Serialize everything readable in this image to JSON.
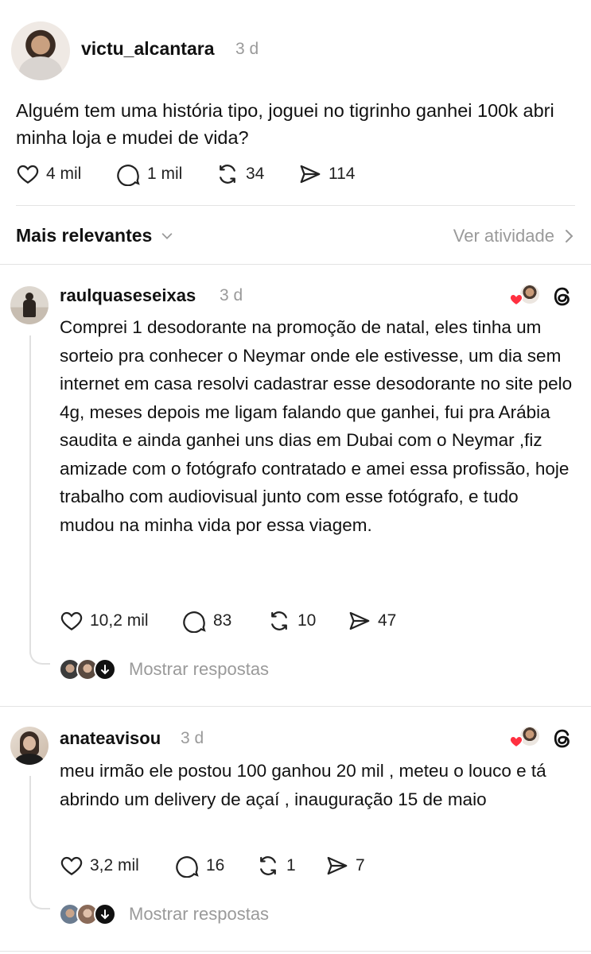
{
  "post": {
    "username": "victu_alcantara",
    "time": "3 d",
    "text": "Alguém tem uma história tipo, joguei no tigrinho ganhei 100k abri minha loja e mudei de vida?",
    "likes": "4 mil",
    "comments": "1 mil",
    "reposts": "34",
    "shares": "114"
  },
  "sort_bar": {
    "label": "Mais relevantes",
    "activity_link": "Ver atividade"
  },
  "replies": [
    {
      "username": "raulquaseseixas",
      "time": "3 d",
      "text": "Comprei 1 desodorante na promoção de natal, eles tinha um sorteio pra conhecer o Neymar onde ele estivesse, um dia sem internet em casa resolvi cadastrar esse desodorante no site pelo 4g, meses depois me ligam falando que ganhei, fui pra Arábia saudita e ainda ganhei uns dias em Dubai com o Neymar ,fiz amizade com o fotógrafo contratado e amei essa profissão, hoje trabalho com audiovisual junto com esse fotógrafo, e tudo mudou na minha vida por essa viagem.",
      "likes": "10,2 mil",
      "comments": "83",
      "reposts": "10",
      "shares": "47",
      "show_replies": "Mostrar respostas"
    },
    {
      "username": "anateavisou",
      "time": "3 d",
      "text": "meu irmão ele postou 100 ganhou 20 mil , meteu o louco e tá abrindo um delivery de açaí , inauguração 15 de maio",
      "likes": "3,2 mil",
      "comments": "16",
      "reposts": "1",
      "shares": "7",
      "show_replies": "Mostrar respostas"
    }
  ],
  "colors": {
    "text": "#111111",
    "muted": "#9a9a9a",
    "divider": "#e3e3e3",
    "like_heart": "#ff3040"
  },
  "icons": [
    "heart-icon",
    "comment-icon",
    "repost-icon",
    "share-icon",
    "chevron-down-icon",
    "chevron-right-icon",
    "threads-icon",
    "arrow-down-icon"
  ]
}
